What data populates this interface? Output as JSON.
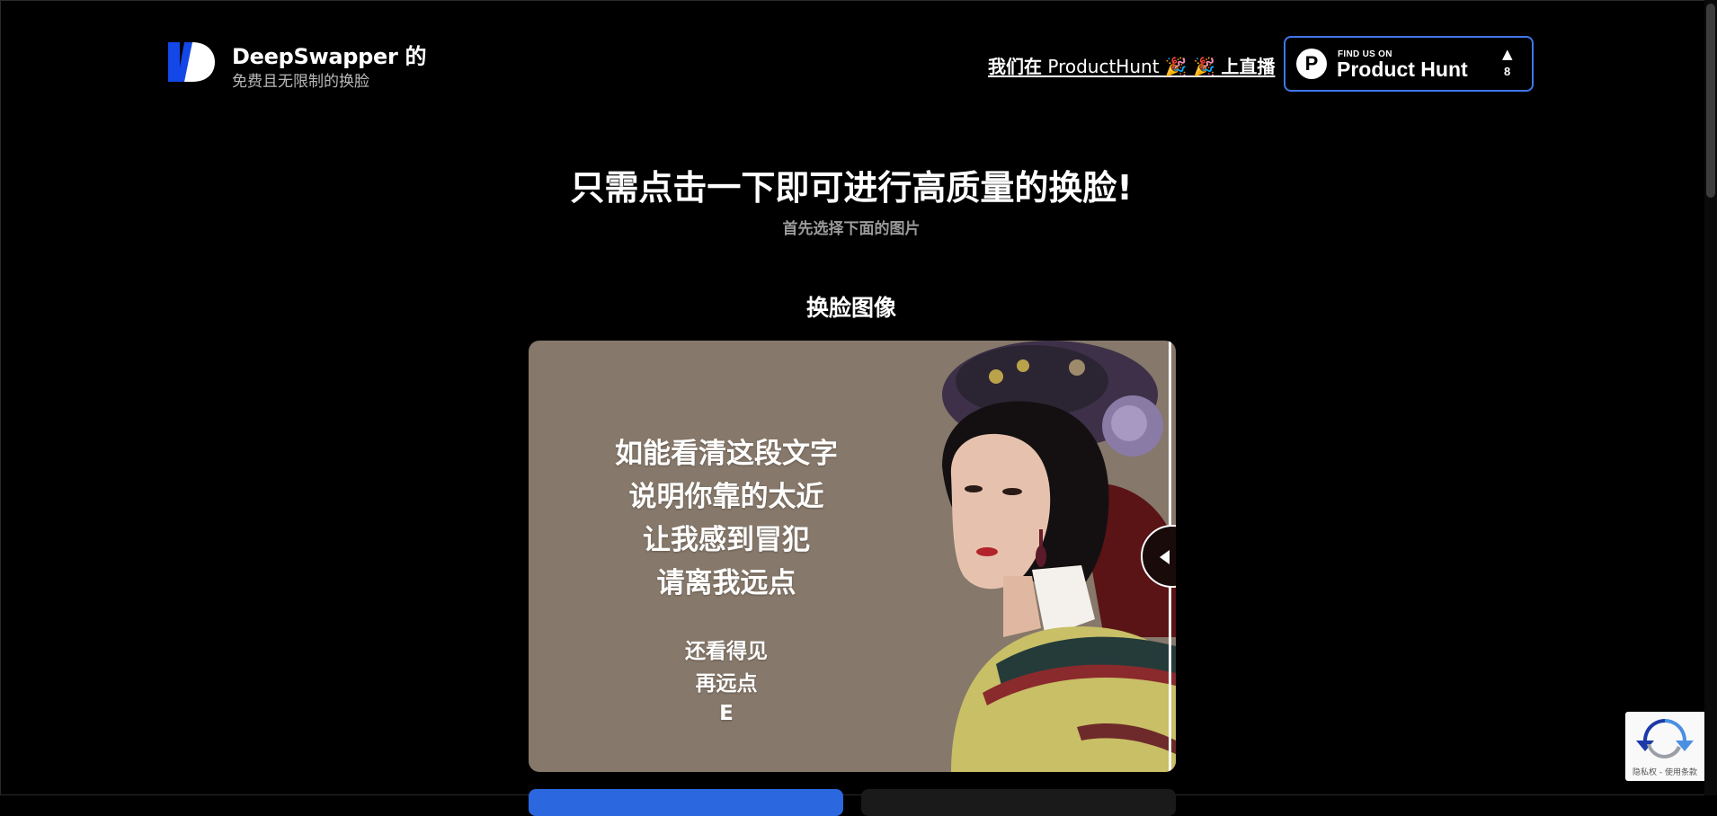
{
  "brand": {
    "name": "DeepSwapper 的",
    "tagline": "免费且无限制的换脸",
    "accent_color": "#1347e8"
  },
  "header": {
    "producthunt_link": {
      "before": "我们在",
      "middle": "ProductHunt 🎉 🎉",
      "after": "上直播"
    },
    "producthunt_badge": {
      "find_label": "FIND US ON",
      "name": "Product Hunt",
      "logo_letter": "P",
      "arrow": "▲",
      "count": "8",
      "border_color": "#3f77e8"
    }
  },
  "hero": {
    "title": "只需点击一下即可进行高质量的换脸!",
    "subtitle": "首先选择下面的图片"
  },
  "face_section": {
    "title": "换脸图像",
    "poster_lines": [
      "如能看清这段文字",
      "说明你靠的太近",
      "让我感到冒犯",
      "请离我远点"
    ],
    "poster_small_lines": [
      "还看得见",
      "再远点",
      "E"
    ]
  },
  "recaptcha": {
    "footer": "隐私权 - 使用条款"
  }
}
